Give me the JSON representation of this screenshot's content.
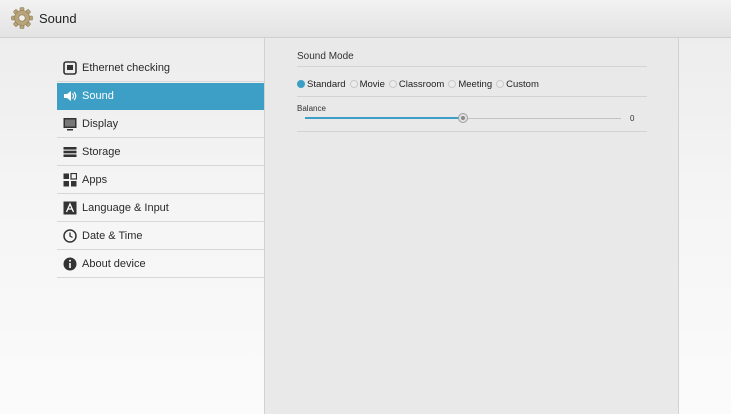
{
  "app": {
    "title": "Sound",
    "icon": "gear-icon"
  },
  "sidebar": {
    "items": [
      {
        "name": "sidebar-item-ethernet-checking",
        "label": "Ethernet checking",
        "icon": "ethernet-icon",
        "active": false
      },
      {
        "name": "sidebar-item-sound",
        "label": "Sound",
        "icon": "speaker-icon",
        "active": true
      },
      {
        "name": "sidebar-item-display",
        "label": "Display",
        "icon": "display-icon",
        "active": false
      },
      {
        "name": "sidebar-item-storage",
        "label": "Storage",
        "icon": "storage-icon",
        "active": false
      },
      {
        "name": "sidebar-item-apps",
        "label": "Apps",
        "icon": "apps-icon",
        "active": false
      },
      {
        "name": "sidebar-item-language-input",
        "label": "Language & Input",
        "icon": "language-icon",
        "active": false
      },
      {
        "name": "sidebar-item-date-time",
        "label": "Date & Time",
        "icon": "clock-icon",
        "active": false
      },
      {
        "name": "sidebar-item-about-device",
        "label": "About device",
        "icon": "info-icon",
        "active": false
      }
    ]
  },
  "sound_mode": {
    "title": "Sound Mode",
    "options": [
      "Standard",
      "Movie",
      "Classroom",
      "Meeting",
      "Custom"
    ],
    "selected": "Standard"
  },
  "balance": {
    "label": "Balance",
    "value": "0",
    "position": 0.5
  },
  "colors": {
    "accent": "#3d9fc6"
  }
}
